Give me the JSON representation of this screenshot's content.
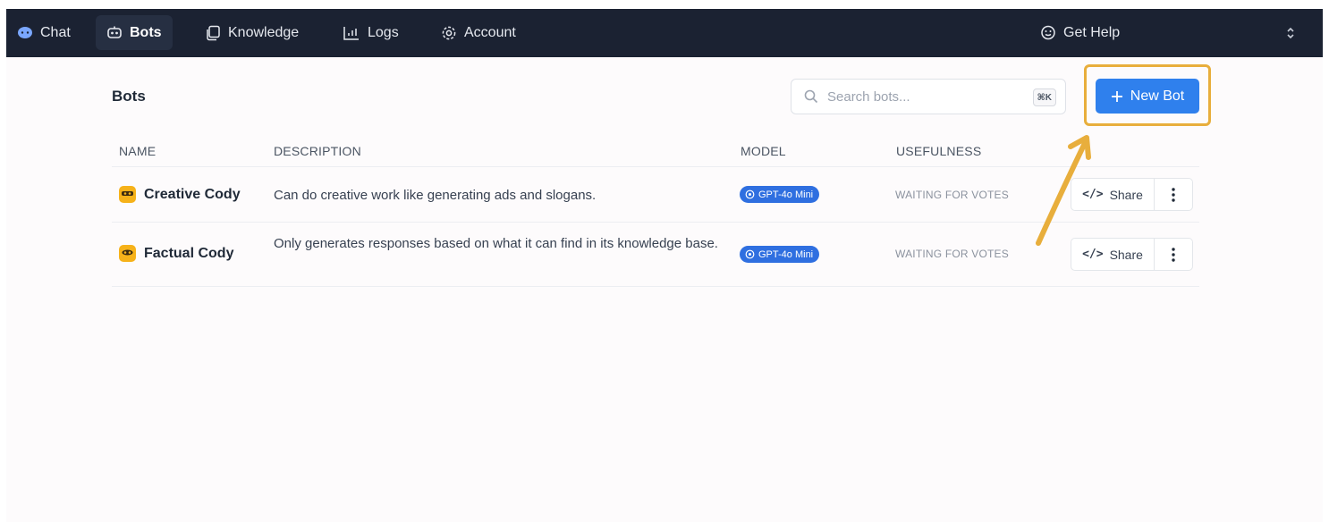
{
  "nav": {
    "chat": "Chat",
    "bots": "Bots",
    "knowledge": "Knowledge",
    "logs": "Logs",
    "account": "Account",
    "help": "Get Help"
  },
  "page": {
    "title": "Bots",
    "search_placeholder": "Search bots...",
    "search_shortcut": "⌘K",
    "new_bot": "New Bot"
  },
  "table": {
    "headers": [
      "NAME",
      "DESCRIPTION",
      "MODEL",
      "USEFULNESS"
    ],
    "rows": [
      {
        "name": "Creative Cody",
        "description": "Can do creative work like generating ads and slogans.",
        "model": "GPT-4o Mini",
        "usefulness": "WAITING FOR VOTES",
        "share": "Share"
      },
      {
        "name": "Factual Cody",
        "description": "Only generates responses based on what it can find in its knowledge base.",
        "model": "GPT-4o Mini",
        "usefulness": "WAITING FOR VOTES",
        "share": "Share"
      }
    ]
  },
  "colors": {
    "nav_bg": "#1b2232",
    "accent": "#2f80ed",
    "highlight": "#e8ae3c",
    "bot_icon": "#f6b21a"
  }
}
